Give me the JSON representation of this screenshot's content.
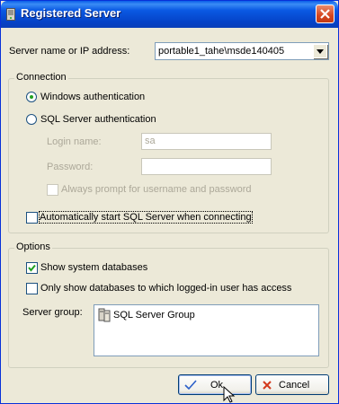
{
  "window": {
    "title": "Registered Server"
  },
  "server": {
    "label": "Server name or IP address:",
    "value": "portable1_tahe\\msde140405"
  },
  "connection": {
    "legend": "Connection",
    "windows_auth_label": "Windows authentication",
    "windows_auth_selected": true,
    "sql_auth_label": "SQL Server authentication",
    "sql_auth_selected": false,
    "login_label": "Login name:",
    "login_value": "sa",
    "password_label": "Password:",
    "password_value": "",
    "always_prompt_label": "Always prompt for username and password",
    "always_prompt_checked": false,
    "autostart_label": "Automatically start SQL Server when connecting",
    "autostart_checked": false
  },
  "options": {
    "legend": "Options",
    "show_system_label": "Show system databases",
    "show_system_checked": true,
    "only_show_label": "Only show databases to which logged-in user has access",
    "only_show_checked": false,
    "server_group_label": "Server group:",
    "server_groups": [
      "SQL Server Group"
    ]
  },
  "buttons": {
    "ok_label": "Ok",
    "cancel_label": "Cancel"
  },
  "colors": {
    "titlebar": "#0a59e3",
    "dialog_bg": "#ece9d8",
    "check_green": "#21a121",
    "cancel_red": "#d33a1e",
    "ok_blue": "#2b5fc9"
  },
  "icons": {
    "title": "server-icon",
    "close": "close-icon",
    "dropdown": "chevron-down-icon",
    "group": "server-group-icon",
    "ok": "checkmark-icon",
    "cancel": "x-icon",
    "cursor": "mouse-cursor-icon"
  }
}
